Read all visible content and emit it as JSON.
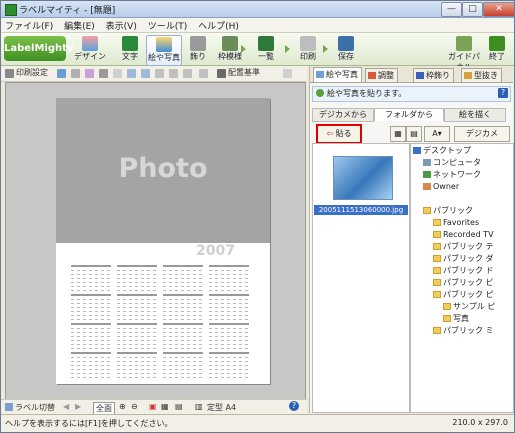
{
  "window": {
    "title": "ラベルマイティ - [無題]",
    "controls": [
      "—",
      "□",
      "✕"
    ]
  },
  "menu": [
    "ファイル(F)",
    "編集(E)",
    "表示(V)",
    "ツール(T)",
    "ヘルプ(H)"
  ],
  "ribbon": {
    "logo": "LabelMighty",
    "buttons": [
      "デザイン",
      "文字",
      "絵や写真",
      "飾り",
      "枠模様",
      "一覧",
      "印刷",
      "保存",
      "ガイドパネル",
      "終了"
    ]
  },
  "left_toolbar": {
    "items": [
      "印刷設定",
      "配置基準",
      "元に戻す"
    ]
  },
  "canvas": {
    "photo_text": "Photo",
    "year": "2007"
  },
  "left_status": {
    "label": "ラベル切替",
    "zoom": "全面",
    "paper": "定型 A4"
  },
  "right_panel": {
    "tabs": [
      "絵や写真",
      "調整",
      "枠飾り",
      "型抜き"
    ],
    "info": "絵や写真を貼ります。",
    "help": "?",
    "subtabs": [
      "デジカメから",
      "フォルダから",
      "絵を描く"
    ],
    "insert_button": "貼る",
    "sort_label": "A",
    "camera_button": "デジカメ",
    "thumbnail_caption": "2005111513060000.jpg",
    "tree": [
      {
        "label": "デスクトップ",
        "level": 0
      },
      {
        "label": "コンピュータ",
        "level": 1
      },
      {
        "label": "ネットワーク",
        "level": 1
      },
      {
        "label": "Owner",
        "level": 1
      },
      {
        "label": "パブリック",
        "level": 1
      },
      {
        "label": "Favorites",
        "level": 2
      },
      {
        "label": "Recorded TV",
        "level": 2
      },
      {
        "label": "パブリック テ",
        "level": 2
      },
      {
        "label": "パブリック ダ",
        "level": 2
      },
      {
        "label": "パブリック ド",
        "level": 2
      },
      {
        "label": "パブリック ビ",
        "level": 2
      },
      {
        "label": "パブリック ピ",
        "level": 2
      },
      {
        "label": "サンプル ピ",
        "level": 3
      },
      {
        "label": "写真",
        "level": 3
      },
      {
        "label": "パブリック ミ",
        "level": 2
      }
    ]
  },
  "status": {
    "message": "ヘルプを表示するには[F1]を押してください。",
    "size": "210.0 x 297.0"
  },
  "colors": {
    "accent_green": "#3e8f22",
    "highlight_red": "#e00000",
    "selection_blue": "#3a6fc7"
  }
}
